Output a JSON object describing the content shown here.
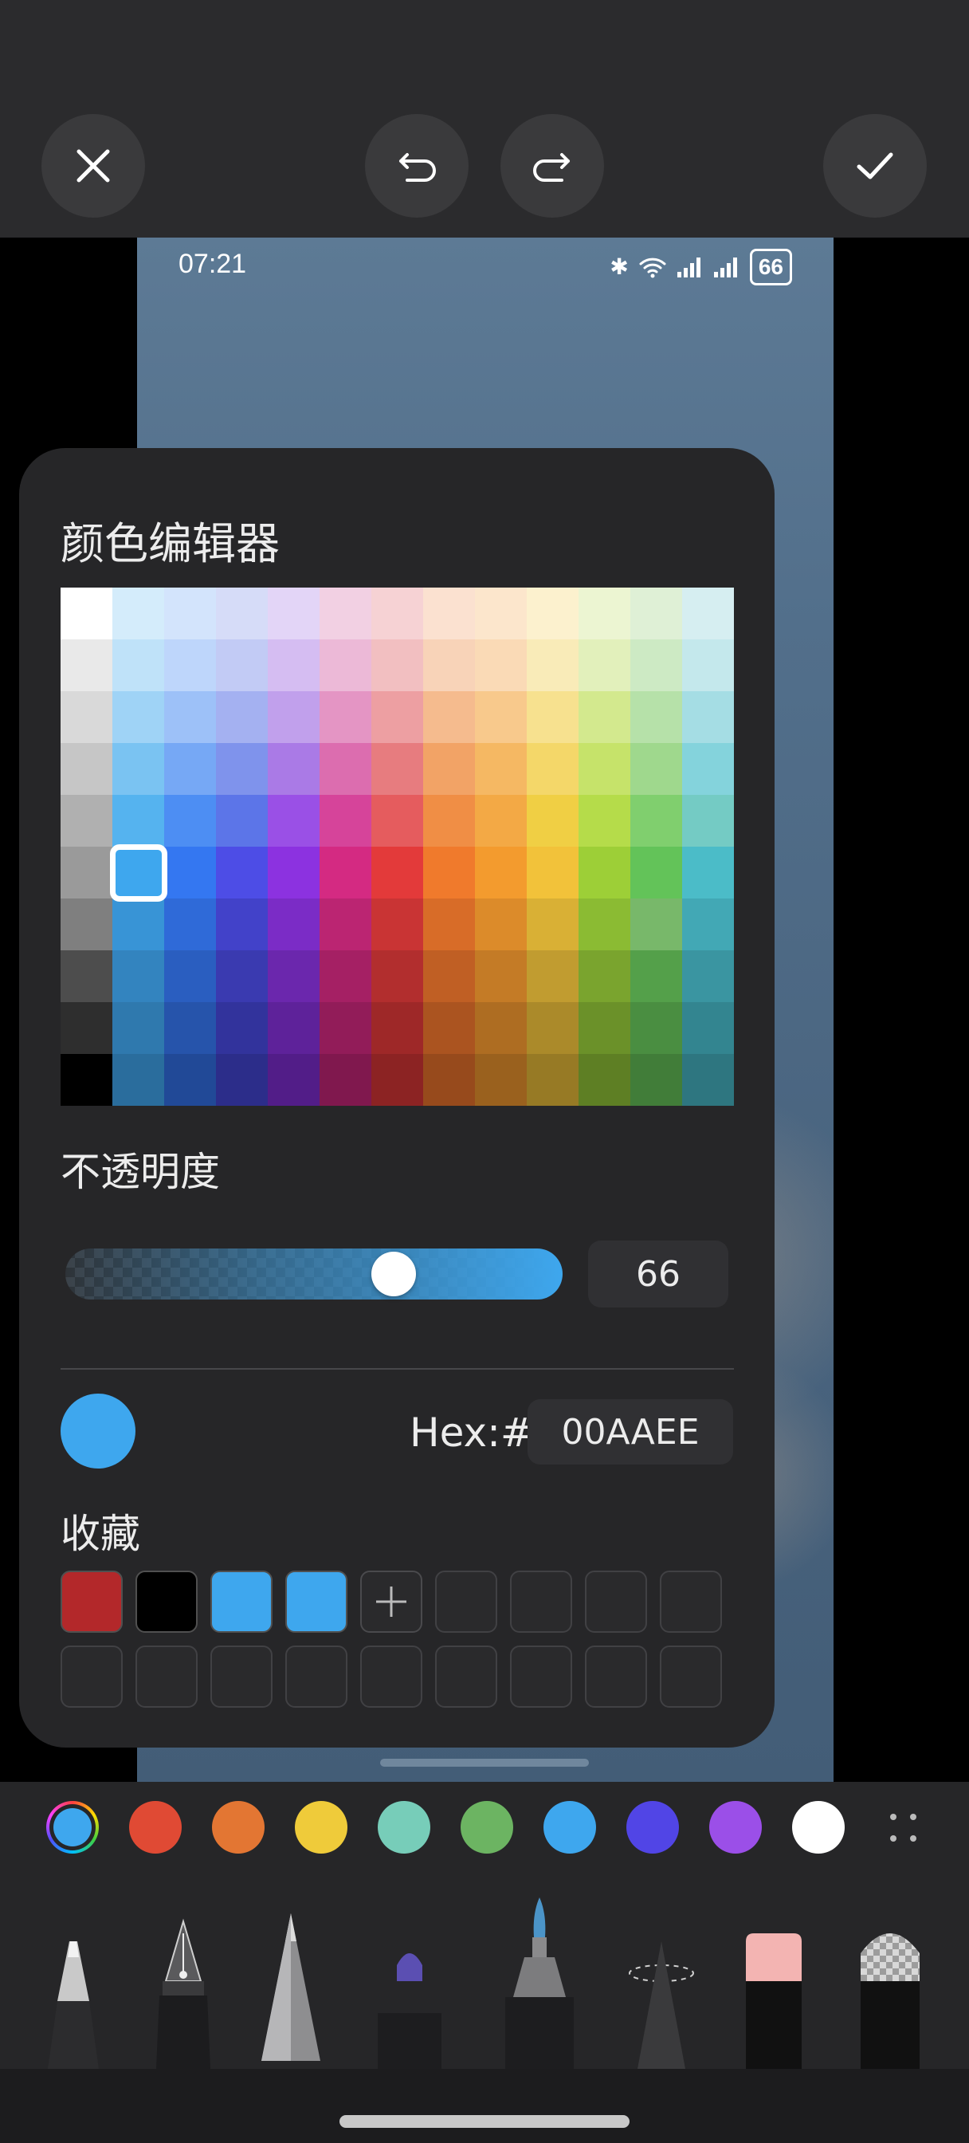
{
  "toolbar": {
    "close_icon": "close-icon",
    "undo_icon": "undo-icon",
    "redo_icon": "redo-icon",
    "confirm_icon": "check-icon"
  },
  "status_bar": {
    "time": "07:21",
    "battery": "66"
  },
  "color_editor": {
    "title": "颜色编辑器",
    "selected_cell": {
      "row": 5,
      "col": 1
    },
    "opacity_label": "不透明度",
    "opacity_value": "66",
    "opacity_fraction": 0.66,
    "hex_label": "Hex:#",
    "hex_value": "00AAEE",
    "current_color": "#3ea7ee",
    "favorites_label": "收藏",
    "favorites": [
      "#b3282a",
      "#000000",
      "#3ea7ee",
      "#3ea7ee"
    ],
    "favorite_slots": 17,
    "grid_colors": [
      [
        "#ffffff",
        "#d4ecfb",
        "#d3e4fc",
        "#d6dcf8",
        "#e3d5f7",
        "#f2d0e3",
        "#f6d2d4",
        "#fbe1d0",
        "#fce6cc",
        "#fcf1ce",
        "#ecf5d2",
        "#dff0d6",
        "#d6eef1"
      ],
      [
        "#e9e9e9",
        "#bfe2f9",
        "#bed6fb",
        "#c2cbf5",
        "#d5bdf2",
        "#ecb9d7",
        "#f2bfc1",
        "#f8d3b8",
        "#fadab6",
        "#f9ebb8",
        "#e2f0bb",
        "#cdeac4",
        "#c4e8ec"
      ],
      [
        "#d9d9d9",
        "#9fd3f6",
        "#9dc1f8",
        "#a4b1f1",
        "#c1a0ec",
        "#e495c4",
        "#ed9fa2",
        "#f5bb8e",
        "#f8c98c",
        "#f7e18f",
        "#d3e98e",
        "#b6e1a9",
        "#a5dde4"
      ],
      [
        "#c6c6c6",
        "#7ac3f2",
        "#76a8f5",
        "#7f93ec",
        "#aa7ae6",
        "#dc6daf",
        "#e77c7f",
        "#f2a366",
        "#f5b863",
        "#f4d769",
        "#c6e36a",
        "#9fd88d",
        "#84d3dc"
      ],
      [
        "#b0b0b0",
        "#55b3ef",
        "#4d8ef3",
        "#5c75e8",
        "#9a50e6",
        "#d6449a",
        "#e55c5e",
        "#f08e45",
        "#f3a945",
        "#f0cf44",
        "#b5dc4a",
        "#80cf6e",
        "#74cbc4"
      ],
      [
        "#9a9a9a",
        "#3ea7ee",
        "#3477f1",
        "#4d4de6",
        "#8c32e0",
        "#d42a82",
        "#e33a3a",
        "#f07a2c",
        "#f39b2e",
        "#f2c23a",
        "#9dcf37",
        "#63c359",
        "#4bbcc8"
      ],
      [
        "#7f7f7f",
        "#3894d6",
        "#2f6ad8",
        "#4242c9",
        "#7b2cc6",
        "#bb2572",
        "#c93434",
        "#d86c28",
        "#dc8b2a",
        "#d9b035",
        "#8bbb33",
        "#78b86a",
        "#42a8b5"
      ],
      [
        "#4d4d4d",
        "#3384bf",
        "#2a5ec0",
        "#3a3ab0",
        "#6b27ad",
        "#a52064",
        "#b22e2e",
        "#c05f24",
        "#c47b26",
        "#c19c30",
        "#7aa42e",
        "#54a04a",
        "#3a95a1"
      ],
      [
        "#2e2e2e",
        "#2f79ae",
        "#2654ab",
        "#32339c",
        "#5e229a",
        "#921c59",
        "#9e2828",
        "#ab5420",
        "#ae6d22",
        "#ab8a2a",
        "#6b9129",
        "#4a8e41",
        "#338590"
      ],
      [
        "#000000",
        "#2a6d9d",
        "#214997",
        "#2c2d8a",
        "#521d88",
        "#80184e",
        "#8c2323",
        "#974a1c",
        "#9a611e",
        "#977a25",
        "#5e7f24",
        "#417d39",
        "#2e7680"
      ]
    ]
  },
  "palette": [
    {
      "color": "#3ea7ee",
      "kind": "color-wheel"
    },
    {
      "color": "#e04a34"
    },
    {
      "color": "#e37633"
    },
    {
      "color": "#efcb3a"
    },
    {
      "color": "#77cdb9"
    },
    {
      "color": "#6cb462"
    },
    {
      "color": "#3ea7ee"
    },
    {
      "color": "#5145e6"
    },
    {
      "color": "#9b4fe8"
    },
    {
      "color": "#ffffff"
    }
  ],
  "tools": [
    {
      "name": "ballpoint-pen"
    },
    {
      "name": "fountain-pen"
    },
    {
      "name": "pencil"
    },
    {
      "name": "marker"
    },
    {
      "name": "brush-pen"
    },
    {
      "name": "airbrush"
    },
    {
      "name": "eraser"
    },
    {
      "name": "transparent-eraser"
    }
  ]
}
